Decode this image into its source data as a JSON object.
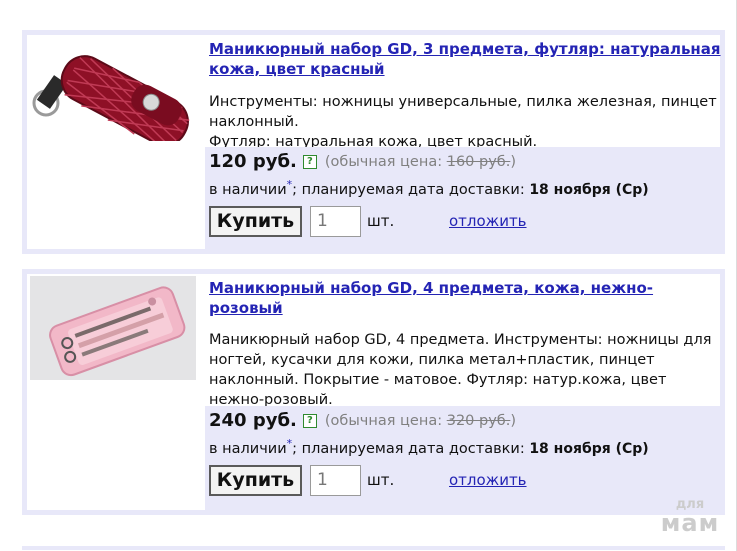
{
  "products": [
    {
      "title": "Маникюрный набор GD, 3 предмета, футляр: натуральная кожа, цвет красный",
      "desc": [
        "Инструменты: ножницы универсальные, пилка железная, пинцет наклонный.",
        "Футляр: натуральная кожа, цвет красный."
      ],
      "price": "120 руб.",
      "help": "?",
      "old_label": "(обычная цена:",
      "old_value": "160 руб.",
      "old_close": ")",
      "avail": "в наличии",
      "avail_star": "*",
      "delivery_text": "; планируемая дата доставки:",
      "delivery_date": "18 ноября (Ср)",
      "buy_label": "Купить",
      "qty": "1",
      "unit": "шт.",
      "defer": "отложить"
    },
    {
      "title": "Маникюрный набор GD, 4 предмета, кожа, нежно-розовый",
      "desc": [
        "Маникюрный набор GD, 4 предмета. Инструменты: ножницы для ногтей, кусачки для кожи, пилка метал+пластик, пинцет наклонный. Покрытие - матовое. Футляр: натур.кожа, цвет нежно-розовый."
      ],
      "price": "240 руб.",
      "help": "?",
      "old_label": "(обычная цена:",
      "old_value": "320 руб.",
      "old_close": ")",
      "avail": "в наличии",
      "avail_star": "*",
      "delivery_text": "; планируемая дата доставки:",
      "delivery_date": "18 ноября (Ср)",
      "buy_label": "Купить",
      "qty": "1",
      "unit": "шт.",
      "defer": "отложить"
    }
  ],
  "watermark": {
    "top": "для",
    "bottom": "мам"
  },
  "colors": {
    "link": "#2424b4",
    "panel": "#e8e8f9",
    "help": "#2f8a2f"
  }
}
